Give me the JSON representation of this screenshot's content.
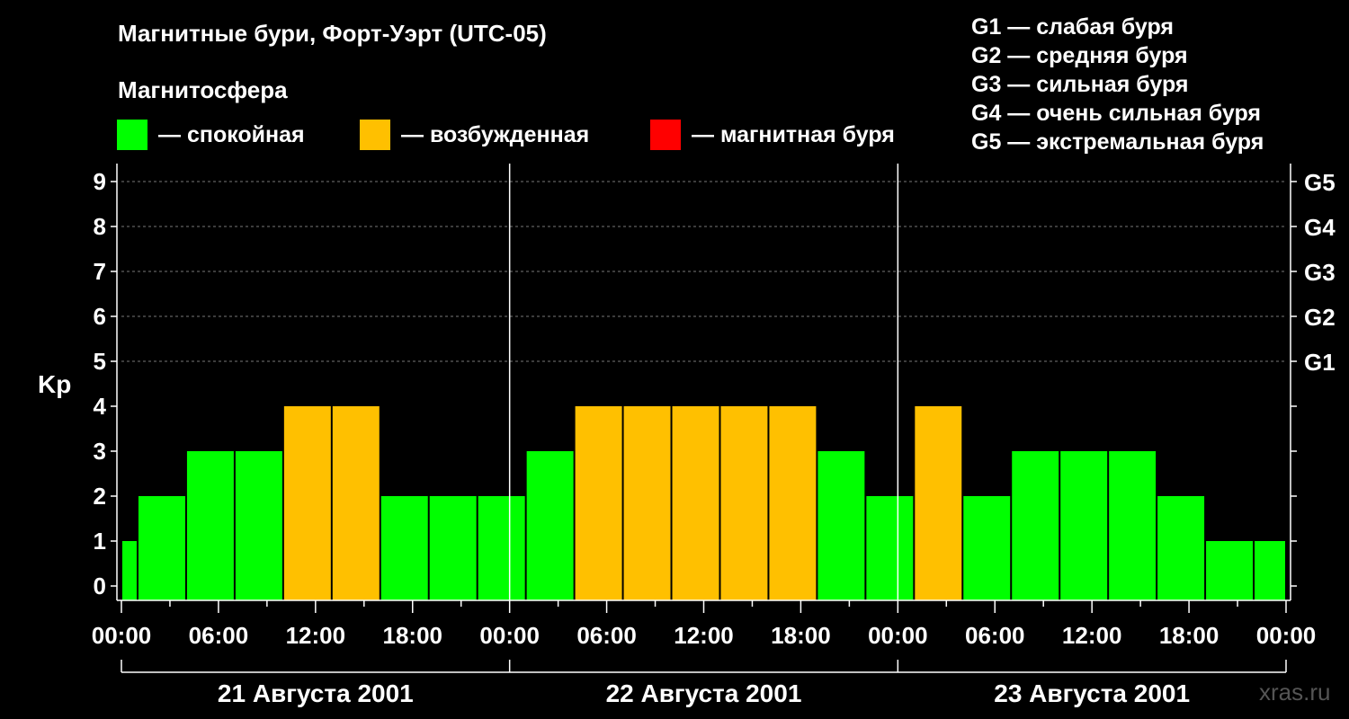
{
  "title": "Магнитные бури, Форт-Уэрт (UTC-05)",
  "magnetosphere_heading": "Магнитосфера",
  "legend": [
    {
      "key": "quiet",
      "label": "— спокойная",
      "color": "#00ff00"
    },
    {
      "key": "active",
      "label": "— возбужденная",
      "color": "#ffc000"
    },
    {
      "key": "storm",
      "label": "— магнитная буря",
      "color": "#ff0000"
    }
  ],
  "storm_levels": [
    "G1 — слабая буря",
    "G2 — средняя буря",
    "G3 — сильная буря",
    "G4 — очень сильная буря",
    "G5 — экстремальная буря"
  ],
  "watermark": "xras.ru",
  "chart_data": {
    "type": "bar",
    "ylabel": "Kp",
    "ylim": [
      0,
      9
    ],
    "yticks": [
      0,
      1,
      2,
      3,
      4,
      5,
      6,
      7,
      8,
      9
    ],
    "right_labels": [
      {
        "value": 5,
        "label": "G1"
      },
      {
        "value": 6,
        "label": "G2"
      },
      {
        "value": 7,
        "label": "G3"
      },
      {
        "value": 8,
        "label": "G4"
      },
      {
        "value": 9,
        "label": "G5"
      }
    ],
    "grid": "horizontal dashed at 5–9",
    "x_hours_range": [
      0,
      72
    ],
    "xtick_labels": [
      "00:00",
      "06:00",
      "12:00",
      "18:00",
      "00:00",
      "06:00",
      "12:00",
      "18:00",
      "00:00",
      "06:00",
      "12:00",
      "18:00",
      "00:00"
    ],
    "days": [
      "21 Августа 2001",
      "22 Августа 2001",
      "23 Августа 2001"
    ],
    "bars": [
      {
        "start": 0,
        "end": 1,
        "kp": 1,
        "level": "quiet"
      },
      {
        "start": 1,
        "end": 4,
        "kp": 2,
        "level": "quiet"
      },
      {
        "start": 4,
        "end": 7,
        "kp": 3,
        "level": "quiet"
      },
      {
        "start": 7,
        "end": 10,
        "kp": 3,
        "level": "quiet"
      },
      {
        "start": 10,
        "end": 13,
        "kp": 4,
        "level": "active"
      },
      {
        "start": 13,
        "end": 16,
        "kp": 4,
        "level": "active"
      },
      {
        "start": 16,
        "end": 19,
        "kp": 2,
        "level": "quiet"
      },
      {
        "start": 19,
        "end": 22,
        "kp": 2,
        "level": "quiet"
      },
      {
        "start": 22,
        "end": 25,
        "kp": 2,
        "level": "quiet"
      },
      {
        "start": 25,
        "end": 28,
        "kp": 3,
        "level": "quiet"
      },
      {
        "start": 28,
        "end": 31,
        "kp": 4,
        "level": "active"
      },
      {
        "start": 31,
        "end": 34,
        "kp": 4,
        "level": "active"
      },
      {
        "start": 34,
        "end": 37,
        "kp": 4,
        "level": "active"
      },
      {
        "start": 37,
        "end": 40,
        "kp": 4,
        "level": "active"
      },
      {
        "start": 40,
        "end": 43,
        "kp": 4,
        "level": "active"
      },
      {
        "start": 43,
        "end": 46,
        "kp": 3,
        "level": "quiet"
      },
      {
        "start": 46,
        "end": 49,
        "kp": 2,
        "level": "quiet"
      },
      {
        "start": 49,
        "end": 52,
        "kp": 4,
        "level": "active"
      },
      {
        "start": 52,
        "end": 55,
        "kp": 2,
        "level": "quiet"
      },
      {
        "start": 55,
        "end": 58,
        "kp": 3,
        "level": "quiet"
      },
      {
        "start": 58,
        "end": 61,
        "kp": 3,
        "level": "quiet"
      },
      {
        "start": 61,
        "end": 64,
        "kp": 3,
        "level": "quiet"
      },
      {
        "start": 64,
        "end": 67,
        "kp": 2,
        "level": "quiet"
      },
      {
        "start": 67,
        "end": 70,
        "kp": 1,
        "level": "quiet"
      },
      {
        "start": 70,
        "end": 72,
        "kp": 1,
        "level": "quiet"
      }
    ]
  }
}
